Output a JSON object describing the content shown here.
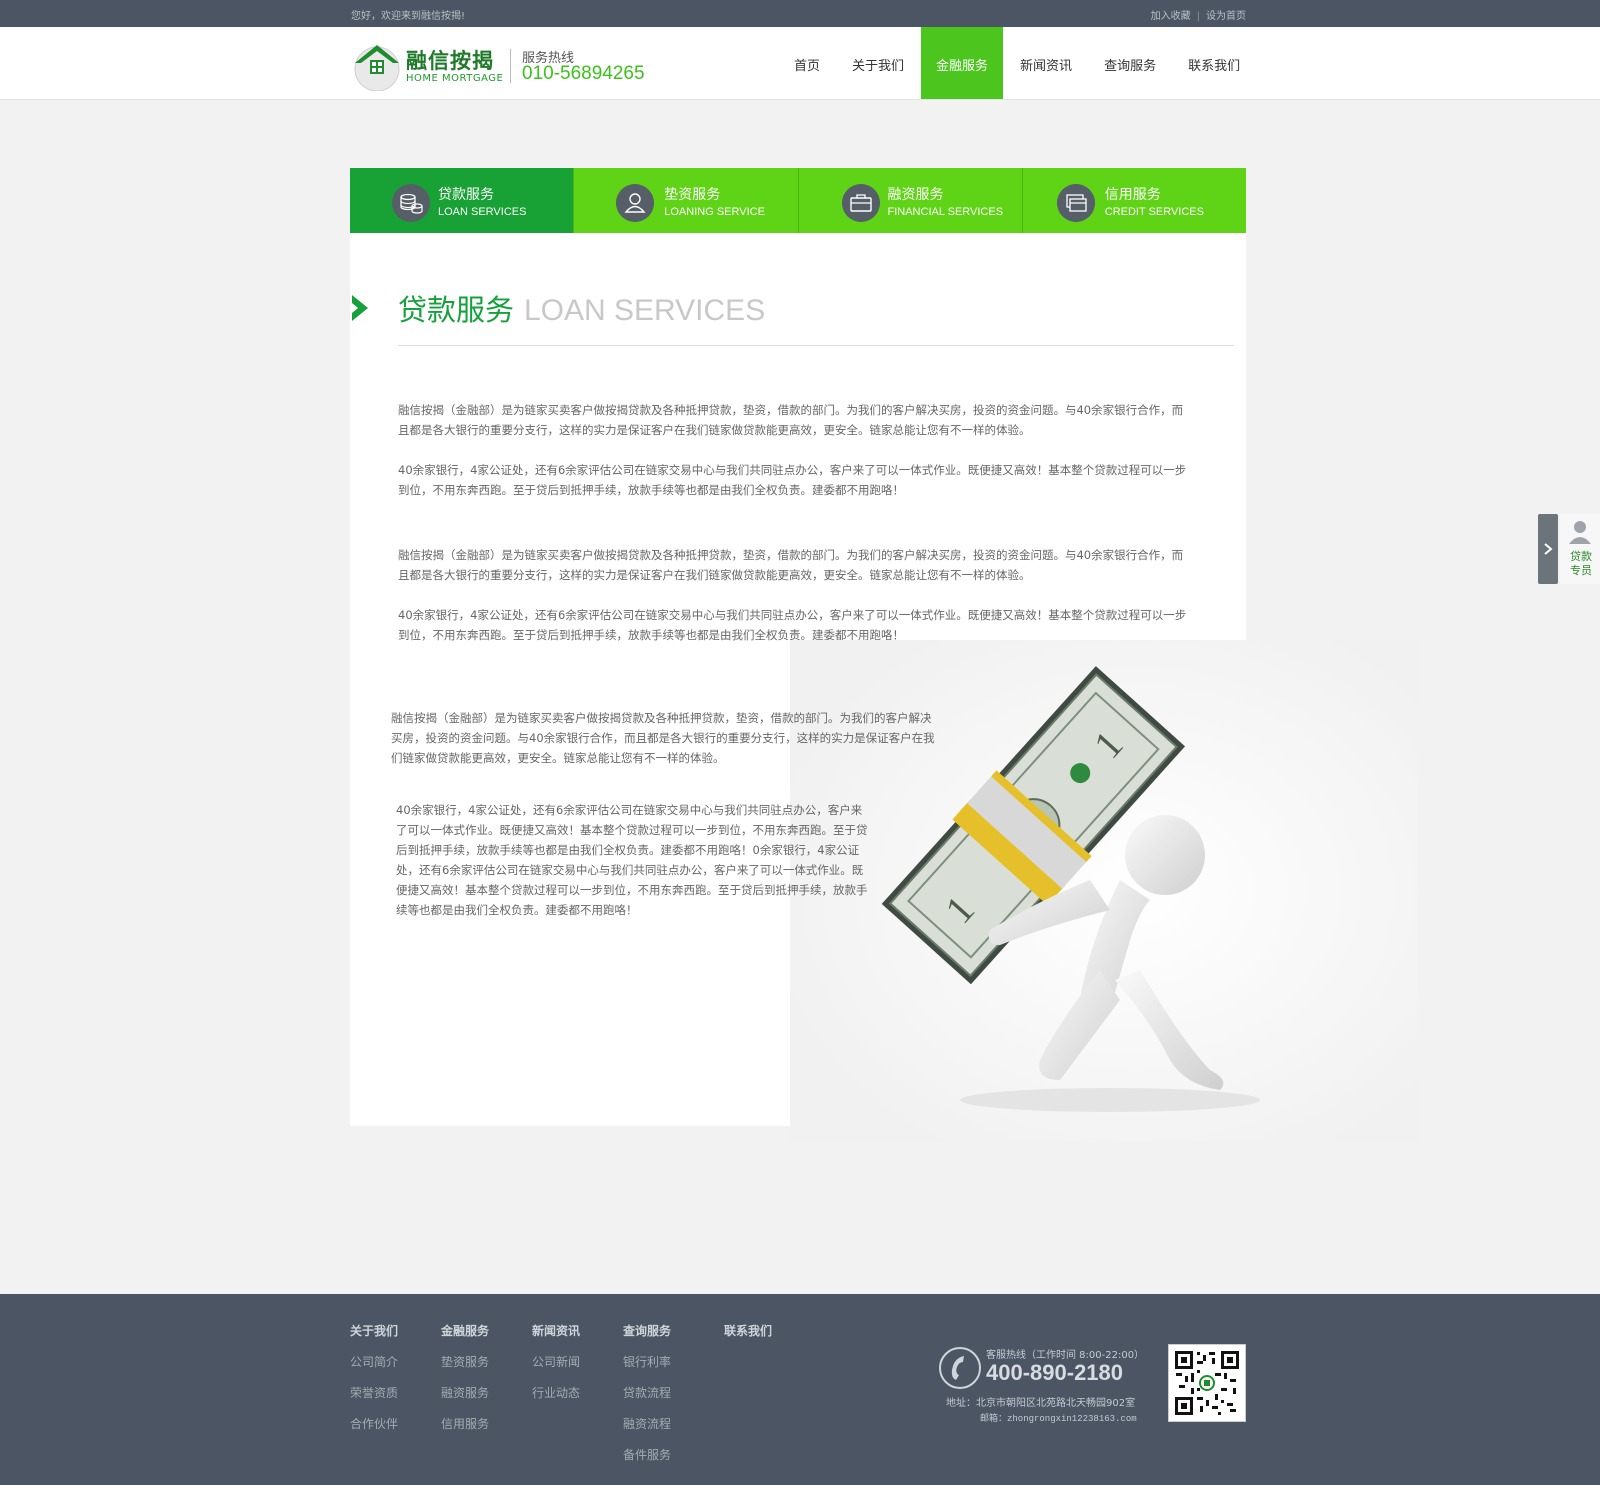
{
  "topbar": {
    "greeting": "您好，欢迎来到融信按揭!",
    "add_favorite": "加入收藏",
    "separator": "|",
    "set_homepage": "设为首页"
  },
  "header": {
    "brand_cn": "融信按揭",
    "brand_en": "HOME MORTGAGE",
    "hotline_label": "服务热线",
    "hotline_number": "010-56894265"
  },
  "nav": {
    "items": [
      "首页",
      "关于我们",
      "金融服务",
      "新闻资讯",
      "查询服务",
      "联系我们"
    ],
    "active_index": 2
  },
  "service_tabs": [
    {
      "cn": "贷款服务",
      "en": "LOAN SERVICES",
      "icon": "coins-icon"
    },
    {
      "cn": "垫资服务",
      "en": "LOANING SERVICE",
      "icon": "user-icon"
    },
    {
      "cn": "融资服务",
      "en": "FINANCIAL SERVICES",
      "icon": "briefcase-icon"
    },
    {
      "cn": "信用服务",
      "en": "CREDIT SERVICES",
      "icon": "cards-icon"
    }
  ],
  "section": {
    "title_cn": "贷款服务",
    "title_en": "LOAN SERVICES"
  },
  "paragraphs": {
    "p1": "融信按揭（金融部）是为链家买卖客户做按揭贷款及各种抵押贷款，垫资，借款的部门。为我们的客户解决买房，投资的资金问题。与40余家银行合作，而且都是各大银行的重要分支行，这样的实力是保证客户在我们链家做贷款能更高效，更安全。链家总能让您有不一样的体验。",
    "p2": "40余家银行，4家公证处，还有6余家评估公司在链家交易中心与我们共同驻点办公，客户来了可以一体式作业。既便捷又高效！基本整个贷款过程可以一步到位，不用东奔西跑。至于贷后到抵押手续，放款手续等也都是由我们全权负责。建委都不用跑咯！",
    "p3": "融信按揭（金融部）是为链家买卖客户做按揭贷款及各种抵押贷款，垫资，借款的部门。为我们的客户解决买房，投资的资金问题。与40余家银行合作，而且都是各大银行的重要分支行，这样的实力是保证客户在我们链家做贷款能更高效，更安全。链家总能让您有不一样的体验。",
    "p4": "40余家银行，4家公证处，还有6余家评估公司在链家交易中心与我们共同驻点办公，客户来了可以一体式作业。既便捷又高效！基本整个贷款过程可以一步到位，不用东奔西跑。至于贷后到抵押手续，放款手续等也都是由我们全权负责。建委都不用跑咯！",
    "p5": "融信按揭（金融部）是为链家买卖客户做按揭贷款及各种抵押贷款，垫资，借款的部门。为我们的客户解决买房，投资的资金问题。与40余家银行合作，而且都是各大银行的重要分支行，这样的实力是保证客户在我们链家做贷款能更高效，更安全。链家总能让您有不一样的体验。",
    "p6": "40余家银行，4家公证处，还有6余家评估公司在链家交易中心与我们共同驻点办公，客户来了可以一体式作业。既便捷又高效！基本整个贷款过程可以一步到位，不用东奔西跑。至于贷后到抵押手续，放款手续等也都是由我们全权负责。建委都不用跑咯！0余家银行，4家公证处，还有6余家评估公司在链家交易中心与我们共同驻点办公，客户来了可以一体式作业。既便捷又高效！基本整个贷款过程可以一步到位，不用东奔西跑。至于贷后到抵押手续，放款手续等也都是由我们全权负责。建委都不用跑咯！"
  },
  "side_panel": {
    "label": "贷款专员"
  },
  "footer": {
    "columns": [
      {
        "title": "关于我们",
        "items": [
          "公司简介",
          "荣誉资质",
          "合作伙伴"
        ]
      },
      {
        "title": "金融服务",
        "items": [
          "垫资服务",
          "融资服务",
          "信用服务"
        ]
      },
      {
        "title": "新闻资讯",
        "items": [
          "公司新闻",
          "行业动态"
        ]
      },
      {
        "title": "查询服务",
        "items": [
          "银行利率",
          "贷款流程",
          "融资流程",
          "备件服务"
        ]
      },
      {
        "title": "联系我们",
        "items": []
      }
    ],
    "hotline_label": "客服热线（工作时间 8:00-22:00）",
    "hotline_number": "400-890-2180",
    "address": "地址：北京市朝阳区北苑路北天畅园902室",
    "email": "邮箱：zhongrongxin12238163.com"
  },
  "colors": {
    "brand_green": "#18a135",
    "light_green": "#5fd316",
    "dark_bar": "#4b5563"
  }
}
